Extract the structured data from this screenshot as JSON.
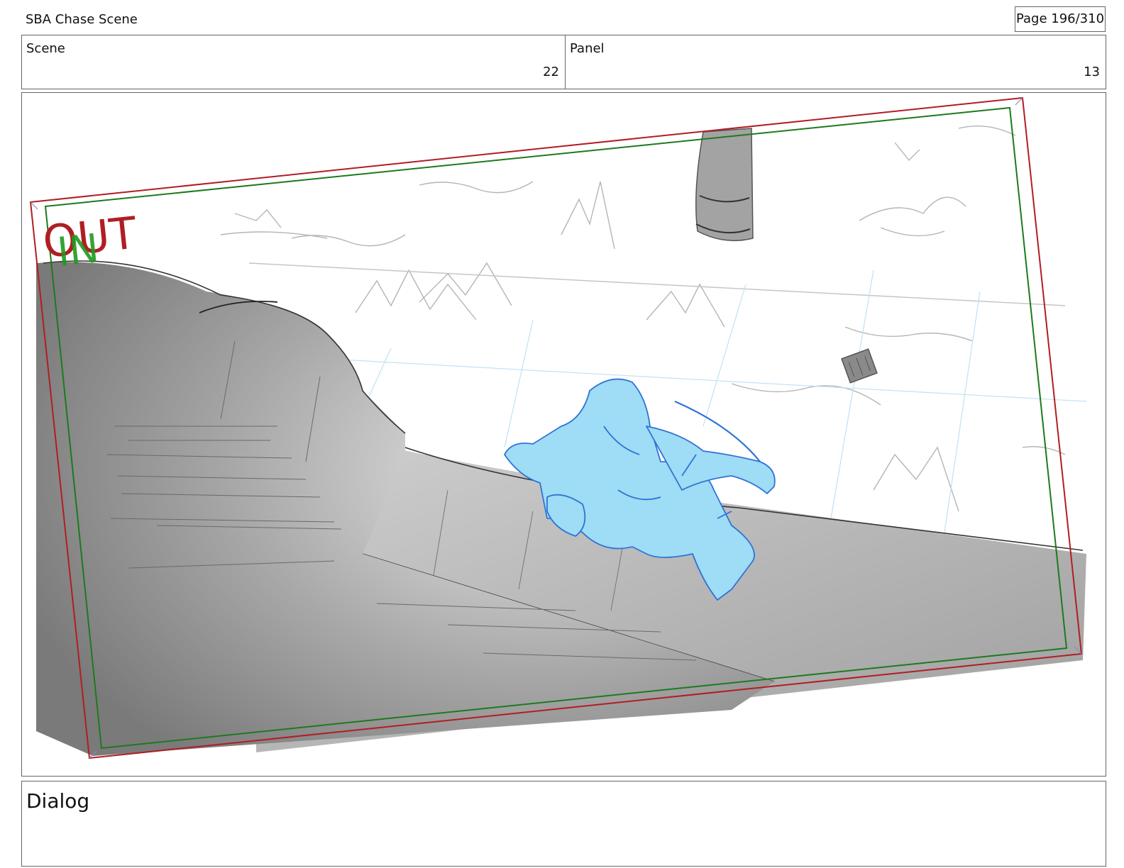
{
  "header": {
    "title": "SBA Chase Scene",
    "page": "Page 196/310"
  },
  "scene": {
    "label": "Scene",
    "value": "22"
  },
  "panel": {
    "label": "Panel",
    "value": "13"
  },
  "frame_labels": {
    "out": "OUT",
    "in": "IN"
  },
  "dialog": {
    "label": "Dialog",
    "text": ""
  },
  "colors": {
    "out_frame": "#b01e24",
    "in_frame": "#1d7a1d",
    "character": "#9fdcf5",
    "character_line": "#2f73d6",
    "ground": "#9a9a9a"
  }
}
